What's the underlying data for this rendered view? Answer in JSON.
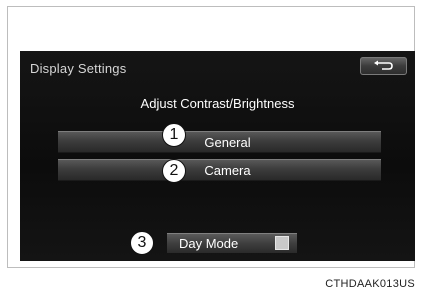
{
  "screen": {
    "title": "Display Settings",
    "back_icon": "return-arrow-icon",
    "subheading": "Adjust Contrast/Brightness",
    "buttons": [
      {
        "label": "General"
      },
      {
        "label": "Camera"
      }
    ],
    "day_mode": {
      "label": "Day Mode",
      "indicator_icon": "indicator-square-icon"
    }
  },
  "callouts": [
    "1",
    "2",
    "3"
  ],
  "figure_code": "CTHDAAK013US",
  "colors": {
    "screen_bg": "#111111",
    "button_face": "#3d3d3d",
    "text": "#ffffff",
    "title_text": "#d6d6d6"
  }
}
